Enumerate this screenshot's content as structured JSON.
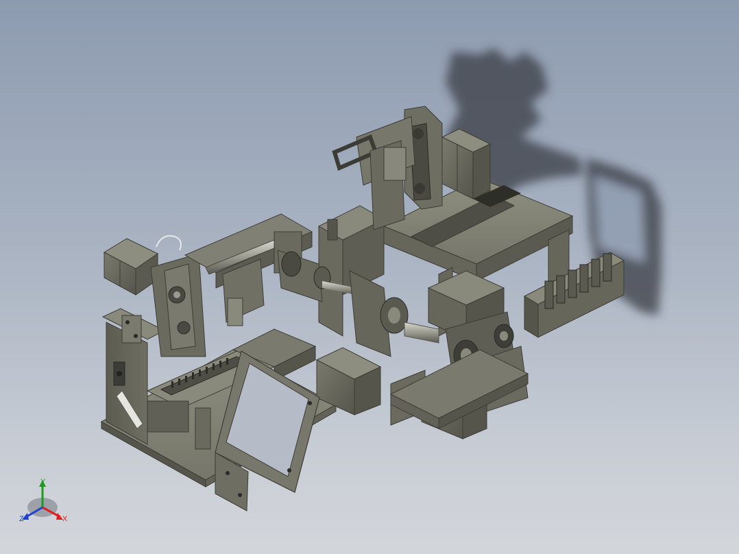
{
  "viewport": {
    "background_top": "#8d9bb0",
    "background_bottom": "#d3d6db",
    "model_color": "#6e6e62",
    "model_dark": "#4a4a42",
    "model_light": "#8a8a7c",
    "shadow_color": "#3a3d44"
  },
  "triad": {
    "x_label": "X",
    "y_label": "Y",
    "z_label": "Z",
    "x_color": "#e02020",
    "y_color": "#1c9a1c",
    "z_color": "#2040d0"
  }
}
